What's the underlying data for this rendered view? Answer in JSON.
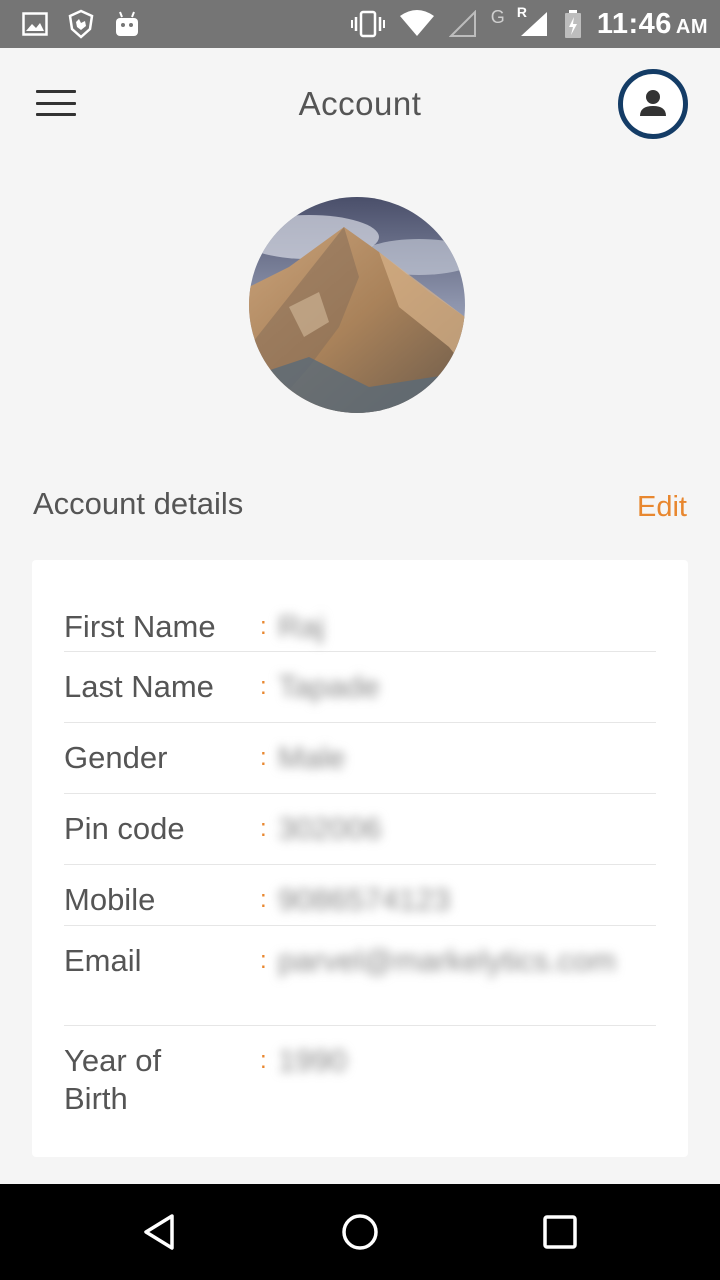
{
  "status_bar": {
    "time": "11:46",
    "ampm": "AM",
    "network_g": "G",
    "roaming": "R",
    "icons_left": [
      "image-icon",
      "hand-shield-icon",
      "android-icon"
    ],
    "icons_right": [
      "vibrate-icon",
      "wifi-icon",
      "signal-empty-icon",
      "signal-icon",
      "battery-icon"
    ]
  },
  "header": {
    "title": "Account"
  },
  "account": {
    "section_title": "Account details",
    "edit_label": "Edit",
    "colon": ":",
    "fields": [
      {
        "label": "First Name",
        "value": "Raj"
      },
      {
        "label": "Last Name",
        "value": "Tapade"
      },
      {
        "label": "Gender",
        "value": "Male"
      },
      {
        "label": "Pin code",
        "value": "302006"
      },
      {
        "label": "Mobile",
        "value": "9086574123"
      },
      {
        "label": "Email",
        "value": "parvel@markelytics.com"
      },
      {
        "label": "Year of Birth",
        "value": "1990"
      }
    ]
  },
  "colors": {
    "accent": "#e8872f",
    "profile_ring": "#143c66",
    "status_bar": "#757575",
    "background": "#f5f5f5"
  }
}
